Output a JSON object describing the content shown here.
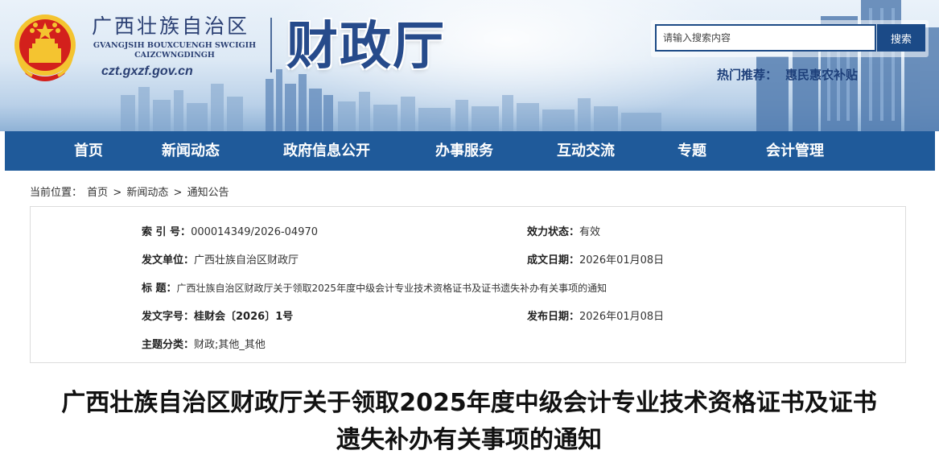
{
  "header": {
    "region_name_cn": "广西壮族自治区",
    "region_name_en_line1": "GVANGJSIH BOUXCUENGH SWCIGIH",
    "region_name_en_line2": "CAIZCWNGDINGH",
    "site_url": "czt.gxzf.gov.cn",
    "department_title": "财政厅",
    "search": {
      "placeholder": "请输入搜索内容",
      "button_label": "搜索"
    },
    "hot": {
      "label": "热门推荐：",
      "link": "惠民惠农补贴"
    }
  },
  "nav": {
    "items": [
      "首页",
      "新闻动态",
      "政府信息公开",
      "办事服务",
      "互动交流",
      "专题",
      "会计管理"
    ]
  },
  "breadcrumb": {
    "prefix": "当前位置：",
    "items": [
      "首页",
      "新闻动态",
      "通知公告"
    ],
    "separator": ">"
  },
  "document_info": {
    "index_no": {
      "label": "索  引  号：",
      "value": "000014349/2026-04970"
    },
    "status": {
      "label": "效力状态：",
      "value": "有效"
    },
    "issuer": {
      "label": "发文单位：",
      "value": "广西壮族自治区财政厅"
    },
    "created_date": {
      "label": "成文日期：",
      "value": "2026年01月08日"
    },
    "title": {
      "label": "标        题：",
      "value": "广西壮族自治区财政厅关于领取2025年度中级会计专业技术资格证书及证书遗失补办有关事项的通知"
    },
    "doc_number": {
      "label": "发文字号：",
      "value": "桂财会〔2026〕1号"
    },
    "published_date": {
      "label": "发布日期：",
      "value": "2026年01月08日"
    },
    "category": {
      "label": "主题分类：",
      "value": "财政;其他_其他"
    }
  },
  "article": {
    "title_line1": "广西壮族自治区财政厅关于领取2025年度中级会计专业技术资格证书及证书",
    "title_line2": "遗失补办有关事项的通知"
  },
  "colors": {
    "nav_bg": "#1f5a9a",
    "header_text": "#2a3f73",
    "emblem_red": "#d3201c",
    "emblem_gold": "#f4c430",
    "search_button": "#1b4a87"
  }
}
